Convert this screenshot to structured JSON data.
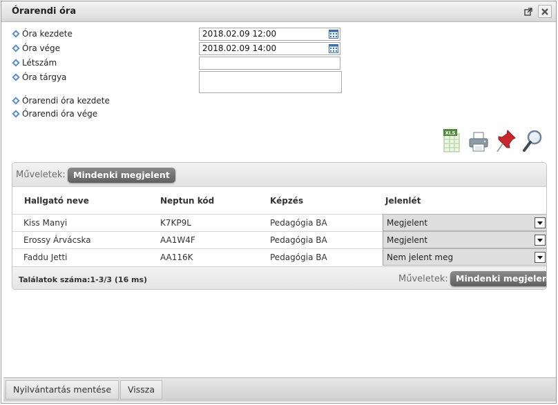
{
  "window": {
    "title": "Órarendi óra",
    "popout_icon": "popout-icon",
    "close_icon": "close-icon"
  },
  "form": {
    "fields": [
      {
        "label": "Óra kezdete",
        "value": "2018.02.09 12:00"
      },
      {
        "label": "Óra vége",
        "value": "2018.02.09 14:00"
      },
      {
        "label": "Létszám",
        "value": ""
      },
      {
        "label": "Óra tárgya",
        "value": ""
      },
      {
        "label": "Órarendi óra kezdete"
      },
      {
        "label": "Órarendi óra vége"
      }
    ]
  },
  "toolbar": {
    "icons": [
      "xls-export-icon",
      "print-icon",
      "pin-icon",
      "search-icon"
    ],
    "xls_text": "XLS"
  },
  "grid": {
    "ops_label": "Műveletek:",
    "ops_button": "Mindenki megjelent",
    "columns": [
      "Hallgató neve",
      "Neptun kód",
      "Képzés",
      "Jelenlét"
    ],
    "rows": [
      {
        "name": "Kiss Manyi",
        "neptun": "K7KP9L",
        "kepzes": "Pedagógia BA",
        "jelenlet": "Megjelent"
      },
      {
        "name": "Erossy Árvácska",
        "neptun": "AA1W4F",
        "kepzes": "Pedagógia BA",
        "jelenlet": "Megjelent"
      },
      {
        "name": "Faddu Jetti",
        "neptun": "AA116K",
        "kepzes": "Pedagógia BA",
        "jelenlet": "Nem jelent meg"
      }
    ],
    "results": "Találatok száma:1-3/3 (16 ms)",
    "footer_ops_label": "Műveletek:",
    "footer_ops_button": "Mindenki megjelent"
  },
  "footer": {
    "save_button": "Nyilvántartás mentése",
    "back_button": "Vissza"
  },
  "colors": {
    "accent": "#5a8fc3",
    "pill": "#6e6e6e"
  }
}
